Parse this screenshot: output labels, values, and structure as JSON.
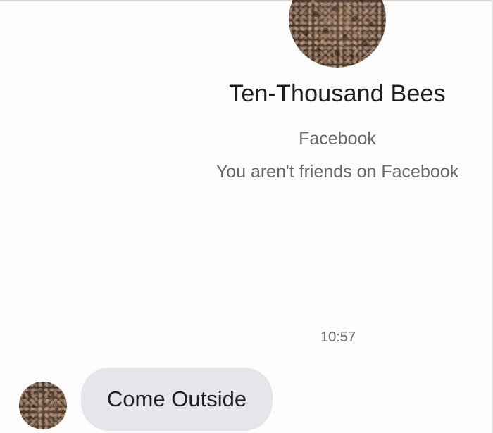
{
  "profile": {
    "name": "Ten-Thousand Bees",
    "platform": "Facebook",
    "relationship_status": "You aren't friends on Facebook"
  },
  "conversation": {
    "timestamp": "10:57",
    "messages": [
      {
        "sender": "Ten-Thousand Bees",
        "text": "Come Outside"
      }
    ]
  },
  "colors": {
    "background": "#fdfdfd",
    "bubble": "#e4e6eb",
    "primary_text": "#1c1e21",
    "secondary_text": "#65676b"
  },
  "icons": {
    "profile_avatar": "bees-avatar-icon",
    "sender_avatar": "bees-avatar-icon"
  }
}
